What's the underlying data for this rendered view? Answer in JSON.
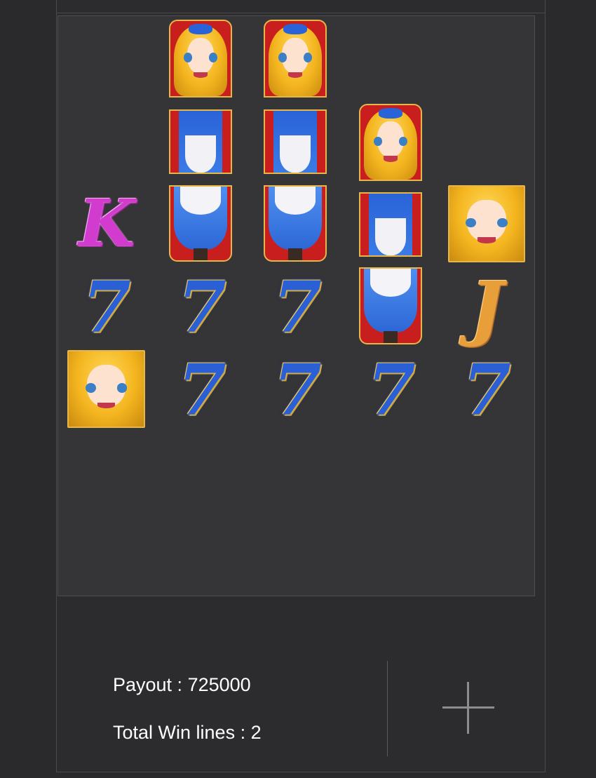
{
  "reels": {
    "seven_symbol": "7",
    "king_symbol": "K",
    "jack_symbol": "J",
    "wild_symbol_name": "alice-wild-icon"
  },
  "summary": {
    "payout_label": "Payout : 725000",
    "win_lines_label": "Total Win lines : 2"
  },
  "controls": {
    "expand_icon": "plus-icon"
  },
  "colors": {
    "seven": "#2a5fd6",
    "king": "#d13ccf",
    "jack": "#e89f3a",
    "wild_frame": "#c81e1e"
  }
}
